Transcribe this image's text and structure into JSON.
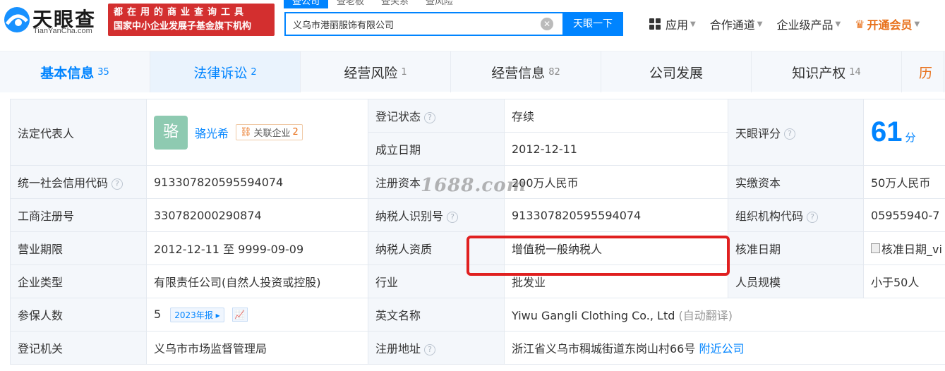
{
  "brand": {
    "name_cn": "天眼查",
    "name_en": "TianYanCha.com",
    "slogan_line1": "都在用的商业查询工具",
    "slogan_line2": "国家中小企业发展子基金旗下机构"
  },
  "search": {
    "tabs": [
      "查公司",
      "查老板",
      "查关系",
      "查风险"
    ],
    "active_tab": 0,
    "value": "义乌市港丽服饰有限公司",
    "button_label": "天眼一下"
  },
  "top_nav": {
    "apps": "应用",
    "channel": "合作通道",
    "enterprise": "企业级产品",
    "vip": "开通会员"
  },
  "section_tabs": [
    {
      "label": "基本信息",
      "count": "35"
    },
    {
      "label": "法律诉讼",
      "count": "2"
    },
    {
      "label": "经营风险",
      "count": "1"
    },
    {
      "label": "经营信息",
      "count": "82"
    },
    {
      "label": "公司发展",
      "count": ""
    },
    {
      "label": "知识产权",
      "count": "14"
    },
    {
      "label": "历",
      "count": ""
    }
  ],
  "info": {
    "legal_rep_label": "法定代表人",
    "legal_rep_avatar": "骆",
    "legal_rep_name": "骆光希",
    "related_label": "关联企业",
    "related_count": "2",
    "reg_status_label": "登记状态",
    "reg_status": "存续",
    "founded_label": "成立日期",
    "founded": "2012-12-11",
    "score_label": "天眼评分",
    "score": "61",
    "score_unit": "分",
    "credit_code_label": "统一社会信用代码",
    "credit_code": "913307820595594074",
    "reg_capital_label": "注册资本",
    "reg_capital": "200万人民币",
    "paid_capital_label": "实缴资本",
    "paid_capital": "50万人民币",
    "biz_reg_no_label": "工商注册号",
    "biz_reg_no": "330782000290874",
    "taxpayer_id_label": "纳税人识别号",
    "taxpayer_id": "913307820595594074",
    "org_code_label": "组织机构代码",
    "org_code": "05955940-7",
    "term_label": "营业期限",
    "term": "2012-12-11 至 9999-09-09",
    "taxpayer_qual_label": "纳税人资质",
    "taxpayer_qual": "增值税一般纳税人",
    "approve_date_label": "核准日期",
    "approve_date_alt": "核准日期_vi",
    "type_label": "企业类型",
    "type": "有限责任公司(自然人投资或控股)",
    "industry_label": "行业",
    "industry": "批发业",
    "staff_size_label": "人员规模",
    "staff_size": "小于50人",
    "insured_label": "参保人数",
    "insured": "5",
    "insured_year": "2023年报",
    "en_name_label": "英文名称",
    "en_name": "Yiwu Gangli Clothing Co., Ltd",
    "en_name_note": "(自动翻译)",
    "authority_label": "登记机关",
    "authority": "义乌市市场监督管理局",
    "address_label": "注册地址",
    "address": "浙江省义乌市稠城街道东岗山村66号",
    "nearby_link": "附近公司"
  },
  "watermark": "1688.com",
  "colors": {
    "accent": "#0084ff",
    "brand_red": "#d32f2f",
    "status_green": "#18a34a",
    "vip_orange": "#e8701a",
    "highlight": "#e02020"
  }
}
